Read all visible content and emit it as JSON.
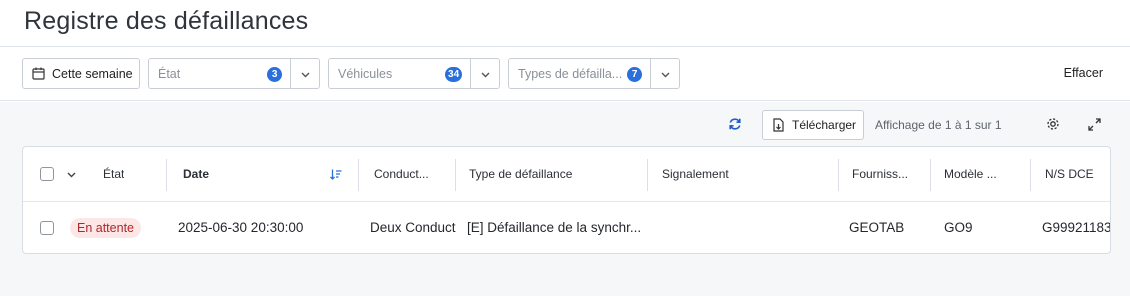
{
  "page": {
    "title": "Registre des défaillances"
  },
  "filters": {
    "date_range": "Cette semaine",
    "etat": {
      "placeholder": "État",
      "count": "3"
    },
    "vehicules": {
      "placeholder": "Véhicules",
      "count": "34"
    },
    "types": {
      "placeholder": "Types de défailla...",
      "count": "7"
    },
    "clear_label": "Effacer"
  },
  "toolbar": {
    "download_label": "Télécharger",
    "pagination": "Affichage de 1 à 1 sur 1"
  },
  "table": {
    "headers": {
      "etat": "État",
      "date": "Date",
      "conducteur": "Conduct...",
      "type": "Type de défaillance",
      "signalement": "Signalement",
      "fournisseur": "Fourniss...",
      "modele": "Modèle ...",
      "ns_dce": "N/S DCE"
    },
    "rows": [
      {
        "etat": "En attente",
        "date": "2025-06-30 20:30:00",
        "conducteur": "Deux Conduct",
        "type": "[E] Défaillance de la synchr...",
        "signalement": "",
        "fournisseur": "GEOTAB",
        "modele": "GO9",
        "ns_dce": "G99921183"
      }
    ]
  },
  "colors": {
    "accent": "#2a6fdb",
    "status_pending_bg": "#fde6e6",
    "status_pending_text": "#b0262a"
  }
}
